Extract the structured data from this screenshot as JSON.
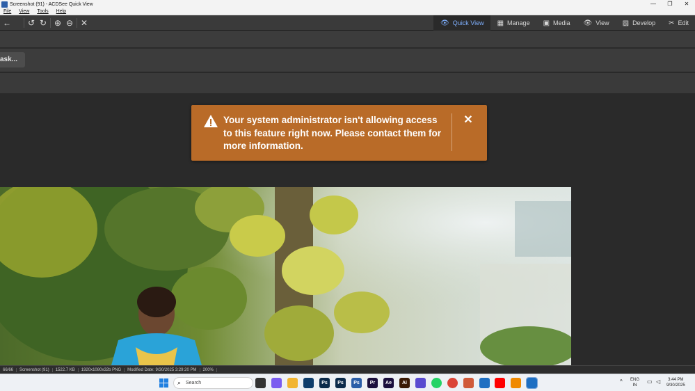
{
  "window": {
    "title": "Screenshot (91) - ACDSee Quick View",
    "controls": [
      "—",
      "❐",
      "✕"
    ]
  },
  "menu": [
    "File",
    "View",
    "Tools",
    "Help"
  ],
  "toolbar": {
    "tools": [
      {
        "name": "back-icon",
        "glyph": "←"
      },
      {
        "name": "rotate-left-icon",
        "glyph": "↺"
      },
      {
        "name": "rotate-right-icon",
        "glyph": "↻"
      },
      {
        "name": "zoom-in-icon",
        "glyph": "⊕"
      },
      {
        "name": "zoom-out-icon",
        "glyph": "⊖"
      },
      {
        "name": "close-image-icon",
        "glyph": "✕"
      }
    ],
    "modes": [
      {
        "label": "Quick View",
        "icon": "eye-icon",
        "glyph": "👁",
        "active": true
      },
      {
        "label": "Manage",
        "icon": "grid-icon",
        "glyph": "▦",
        "active": false
      },
      {
        "label": "Media",
        "icon": "media-icon",
        "glyph": "▣",
        "active": false
      },
      {
        "label": "View",
        "icon": "eye-icon",
        "glyph": "👁",
        "active": false
      },
      {
        "label": "Develop",
        "icon": "develop-icon",
        "glyph": "▨",
        "active": false
      },
      {
        "label": "Edit",
        "icon": "edit-icon",
        "glyph": "✂",
        "active": false
      }
    ]
  },
  "task_button": {
    "label": "ask..."
  },
  "banner": {
    "message": "Your system administrator isn't allowing access to this feature right now. Please contact them for more information.",
    "close_glyph": "✕",
    "color": "#b96b28"
  },
  "statusbar": [
    "66/66",
    "Screenshot (91)",
    "1522.7 KB",
    "1920x1080x32b PNG",
    "Modified Date: 9/30/2025 3:29:20 PM",
    "200%"
  ],
  "taskbar": {
    "search_placeholder": "Search",
    "apps": [
      {
        "name": "file-explorer-icon",
        "label": "",
        "color": "#f2b530"
      },
      {
        "name": "photoshop-icon",
        "label": "Ps",
        "color": "#0b2a4a"
      },
      {
        "name": "photoshop-icon-2",
        "label": "Ps",
        "color": "#0b2a4a"
      },
      {
        "name": "photoshop-icon-3",
        "label": "Ps",
        "color": "#2b5ea8"
      },
      {
        "name": "premiere-icon",
        "label": "Pr",
        "color": "#1b0f3d"
      },
      {
        "name": "after-effects-icon",
        "label": "Ae",
        "color": "#1b0f3d"
      },
      {
        "name": "illustrator-icon",
        "label": "Ai",
        "color": "#3a1a05"
      },
      {
        "name": "app-icon",
        "label": "",
        "color": "#5a4bd0"
      },
      {
        "name": "whatsapp-icon",
        "label": "",
        "color": "#25d366"
      },
      {
        "name": "chrome-icon",
        "label": "",
        "color": "#db4437"
      },
      {
        "name": "app-icon-2",
        "label": "",
        "color": "#d05a3a"
      },
      {
        "name": "acdsee-icon",
        "label": "",
        "color": "#1e6fc2"
      },
      {
        "name": "youtube-icon",
        "label": "",
        "color": "#ff0000"
      },
      {
        "name": "vlc-icon",
        "label": "",
        "color": "#f08a00"
      },
      {
        "name": "acdsee-quickview-icon",
        "label": "",
        "color": "#1e6fc2"
      }
    ],
    "tray": {
      "language": "ENG",
      "region": "IN",
      "time": "3:44 PM",
      "date": "9/30/2025"
    }
  }
}
